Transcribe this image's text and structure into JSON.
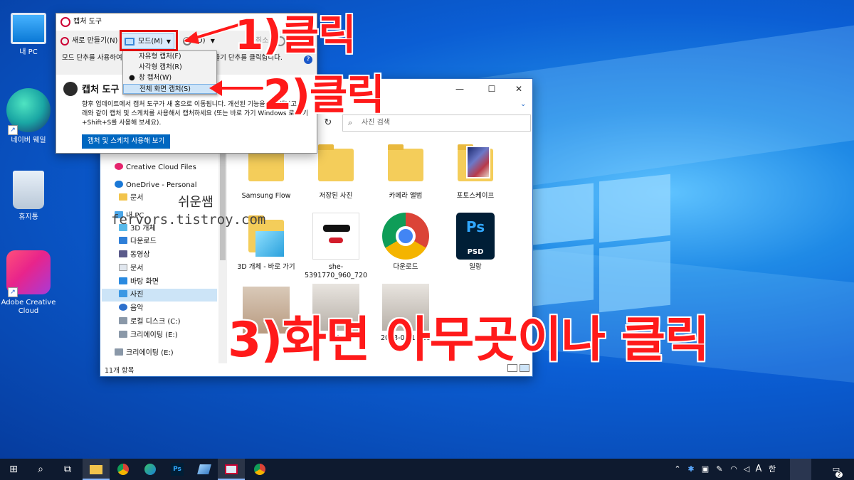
{
  "desktop": {
    "icons": [
      {
        "label": "내 PC"
      },
      {
        "label": "네이버 웨일"
      },
      {
        "label": "휴지통"
      },
      {
        "label": "Adobe Creative Cloud"
      }
    ]
  },
  "explorer": {
    "search_placeholder": "사진 검색",
    "nav": [
      {
        "label": "Creative Cloud Files"
      },
      {
        "label": "OneDrive - Personal"
      },
      {
        "label": "문서"
      },
      {
        "label": "내 PC"
      },
      {
        "label": "3D 개체"
      },
      {
        "label": "다운로드"
      },
      {
        "label": "동영상"
      },
      {
        "label": "문서"
      },
      {
        "label": "바탕 화면"
      },
      {
        "label": "사진"
      },
      {
        "label": "음악"
      },
      {
        "label": "로컬 디스크 (C:)"
      },
      {
        "label": "크리에이팅 (E:)"
      },
      {
        "label": "크리에이팅 (E:)"
      }
    ],
    "files": [
      {
        "label": "Samsung Flow"
      },
      {
        "label": "저장된 사진"
      },
      {
        "label": "카메라 앨범"
      },
      {
        "label": "포토스케이프"
      },
      {
        "label": "3D 개체 - 바로 가기"
      },
      {
        "label": "she-5391770_960_720"
      },
      {
        "label": "다운로드"
      },
      {
        "label": "일랑"
      },
      {
        "label": ""
      },
      {
        "label": "20"
      },
      {
        "label": "2023-02 14:23"
      }
    ],
    "status": "11개 항목"
  },
  "snip": {
    "title": "캡처 도구",
    "new_label": "새로 만들기(N)",
    "mode_label": "모드(M)",
    "delay_label": "(D)",
    "cancel_label": "취소",
    "desc": "모드 단추를 사용하여 캡처 유형을 선택하거나 새로 만들기 단추를 클릭합니다.",
    "banner_title": "캡처 도구",
    "banner_text": "향후 업데이트에서 캡처 도구가 새 홈으로 이동됩니다. 개선된 기능을 사용해보고 원래와 같이 캡처 및 스케치를 사용해서 캡처하세요 (또는 바로 가기 Windows 로고 키+Shift+S를 사용해 보세요).",
    "banner_button": "캡처 및 스케치 사용해 보기",
    "menu": [
      {
        "label": "자유형 캡처(F)"
      },
      {
        "label": "사각형 캡처(R)"
      },
      {
        "label": "창 캡처(W)"
      },
      {
        "label": "전체 화면 캡처(S)"
      }
    ]
  },
  "annotations": {
    "step1": "1)클릭",
    "step2": "2)클릭",
    "step3": "3)화면 아무곳이나 클릭"
  },
  "watermark": {
    "name": "쉬운쌤",
    "url": "fervors.tistroy.com"
  },
  "taskbar": {
    "ime_a": "A",
    "ime_han": "한",
    "notify_count": "2"
  },
  "colors": {
    "annotation_red": "#ff1a1a",
    "accent": "#0067c0"
  }
}
